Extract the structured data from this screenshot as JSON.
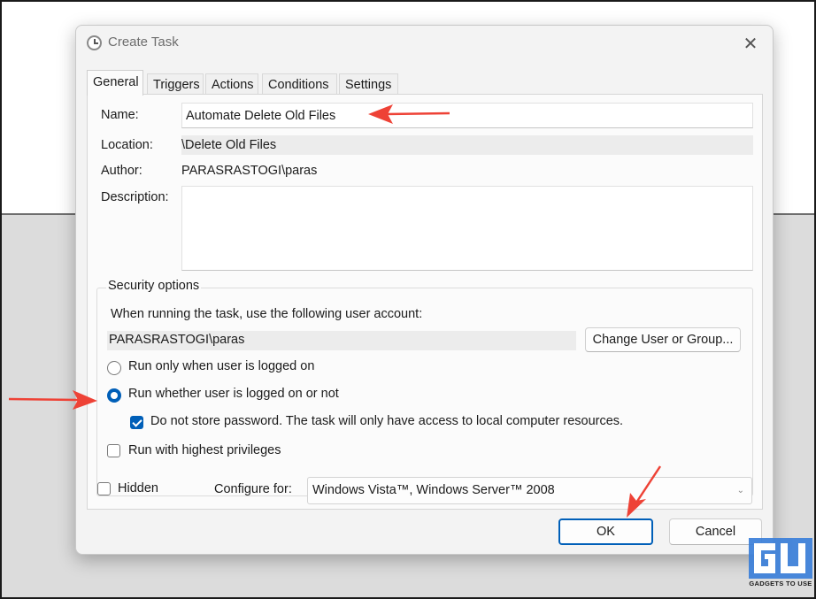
{
  "window": {
    "title": "Create Task",
    "close_glyph": "✕"
  },
  "tabs": [
    {
      "label": "General",
      "active": true
    },
    {
      "label": "Triggers"
    },
    {
      "label": "Actions"
    },
    {
      "label": "Conditions"
    },
    {
      "label": "Settings"
    }
  ],
  "general": {
    "name_label": "Name:",
    "name_value": "Automate Delete Old Files",
    "location_label": "Location:",
    "location_value": "\\Delete Old Files",
    "author_label": "Author:",
    "author_value": "PARASRASTOGI\\paras",
    "description_label": "Description:",
    "description_value": ""
  },
  "security": {
    "title": "Security options",
    "account_prompt": "When running the task, use the following user account:",
    "account_value": "PARASRASTOGI\\paras",
    "change_button": "Change User or Group...",
    "radio_logged_on": "Run only when user is logged on",
    "radio_whether": "Run whether user is logged on or not",
    "selected_radio": "radio_whether",
    "no_store_password": "Do not store password.  The task will only have access to local computer resources.",
    "no_store_password_checked": true,
    "highest_privileges": "Run with highest privileges",
    "highest_privileges_checked": false
  },
  "footer": {
    "hidden_label": "Hidden",
    "hidden_checked": false,
    "configure_label": "Configure for:",
    "configure_value": "Windows Vista™, Windows Server™ 2008"
  },
  "buttons": {
    "ok": "OK",
    "cancel": "Cancel"
  },
  "watermark": {
    "text": "GADGETS TO USE"
  },
  "colors": {
    "accent": "#005fb8",
    "annotation_arrow": "#ee4236",
    "watermark_blue": "#3b7fd9"
  }
}
